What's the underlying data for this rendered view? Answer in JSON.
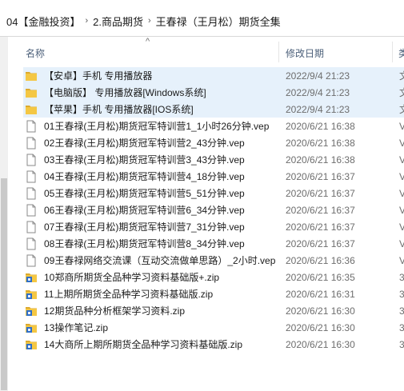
{
  "breadcrumb": [
    "04【金融投资】",
    "2.商品期货",
    "王春禄（王月松）期货全集"
  ],
  "breadcrumb_separator": "›",
  "columns": {
    "name": "名称",
    "date": "修改日期",
    "type": "类"
  },
  "sort_indicator": "^",
  "files": [
    {
      "name": "【安卓】手机 专用播放器",
      "date": "2022/9/4 21:23",
      "type": "文",
      "icon": "folder-icon"
    },
    {
      "name": "【电脑版】 专用播放器[Windows系统]",
      "date": "2022/9/4 21:23",
      "type": "文",
      "icon": "folder-icon"
    },
    {
      "name": "【苹果】手机 专用播放器[IOS系统]",
      "date": "2022/9/4 21:23",
      "type": "文",
      "icon": "folder-icon"
    },
    {
      "name": "01王春禄(王月松)期货冠军特训营1_1小时26分钟.vep",
      "date": "2020/6/21 16:38",
      "type": "V",
      "icon": "file-icon"
    },
    {
      "name": "02王春禄(王月松)期货冠军特训营2_43分钟.vep",
      "date": "2020/6/21 16:38",
      "type": "V",
      "icon": "file-icon"
    },
    {
      "name": "03王春禄(王月松)期货冠军特训营3_43分钟.vep",
      "date": "2020/6/21 16:38",
      "type": "V",
      "icon": "file-icon"
    },
    {
      "name": "04王春禄(王月松)期货冠军特训营4_18分钟.vep",
      "date": "2020/6/21 16:37",
      "type": "V",
      "icon": "file-icon"
    },
    {
      "name": "05王春禄(王月松)期货冠军特训营5_51分钟.vep",
      "date": "2020/6/21 16:37",
      "type": "V",
      "icon": "file-icon"
    },
    {
      "name": "06王春禄(王月松)期货冠军特训营6_34分钟.vep",
      "date": "2020/6/21 16:37",
      "type": "V",
      "icon": "file-icon"
    },
    {
      "name": "07王春禄(王月松)期货冠军特训营7_31分钟.vep",
      "date": "2020/6/21 16:37",
      "type": "V",
      "icon": "file-icon"
    },
    {
      "name": "08王春禄(王月松)期货冠军特训营8_34分钟.vep",
      "date": "2020/6/21 16:37",
      "type": "V",
      "icon": "file-icon"
    },
    {
      "name": "09王春禄网络交流课（互动交流做单思路）_2小时.vep",
      "date": "2020/6/21 16:36",
      "type": "V",
      "icon": "file-icon"
    },
    {
      "name": "10郑商所期货全品种学习资料基础版+.zip",
      "date": "2020/6/21 16:35",
      "type": "3",
      "icon": "zip-icon"
    },
    {
      "name": "11上期所期货全品种学习资料基础版.zip",
      "date": "2020/6/21 16:31",
      "type": "3",
      "icon": "zip-icon"
    },
    {
      "name": "12期货品种分析框架学习资料.zip",
      "date": "2020/6/21 16:30",
      "type": "3",
      "icon": "zip-icon"
    },
    {
      "name": "13操作笔记.zip",
      "date": "2020/6/21 16:30",
      "type": "3",
      "icon": "zip-icon"
    },
    {
      "name": "14大商所上期所期货全品种学习资料基础版.zip",
      "date": "2020/6/21 16:30",
      "type": "3",
      "icon": "zip-icon"
    }
  ],
  "colors": {
    "folder": "#f4c744",
    "folder_row_bg": "#e6f1fb",
    "zip_blue": "#2f6fc9",
    "header_text": "#4c607a"
  }
}
